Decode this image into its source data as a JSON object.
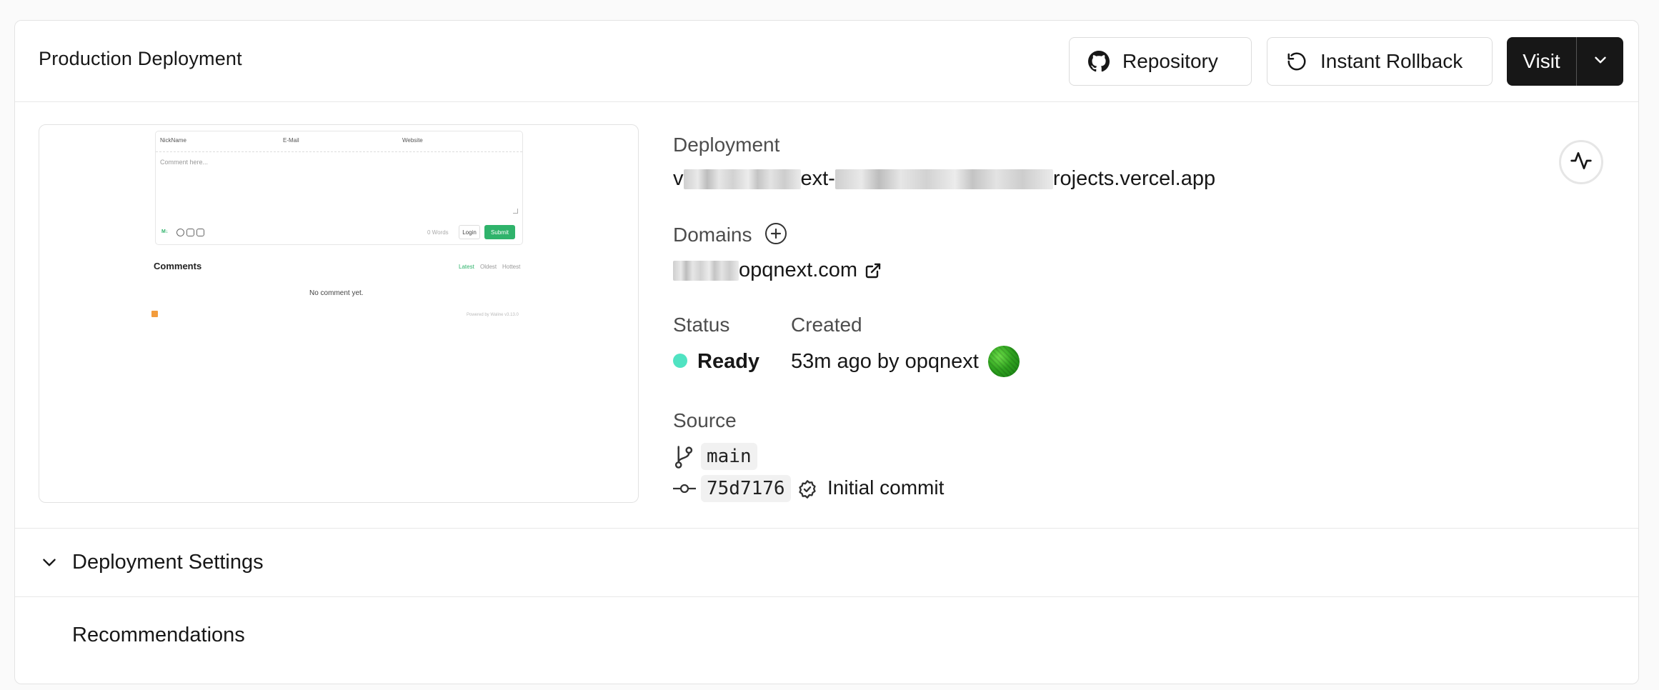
{
  "header": {
    "title": "Production Deployment",
    "repository_label": "Repository",
    "rollback_label": "Instant Rollback",
    "visit_label": "Visit"
  },
  "preview": {
    "nickname": "NickName",
    "email": "E-Mail",
    "website": "Website",
    "placeholder": "Comment here...",
    "markdown_badge": "M↓",
    "words": "0 Words",
    "login": "Login",
    "submit": "Submit",
    "comments_title": "Comments",
    "sort_latest": "Latest",
    "sort_oldest": "Oldest",
    "sort_hottest": "Hottest",
    "empty": "No comment yet.",
    "powered": "Powered by Waline v3.13.0"
  },
  "deployment": {
    "label": "Deployment",
    "url_prefix": "v",
    "url_middle": "ext-",
    "url_suffix": "rojects.vercel.app"
  },
  "domains": {
    "label": "Domains",
    "domain_suffix": "opqnext.com"
  },
  "status": {
    "label": "Status",
    "value": "Ready",
    "color": "#50e3c2"
  },
  "created": {
    "label": "Created",
    "value": "53m ago by opqnext"
  },
  "source": {
    "label": "Source",
    "branch": "main",
    "commit_hash": "75d7176",
    "commit_message": "Initial commit"
  },
  "sections": {
    "settings": "Deployment Settings",
    "recommendations": "Recommendations"
  }
}
